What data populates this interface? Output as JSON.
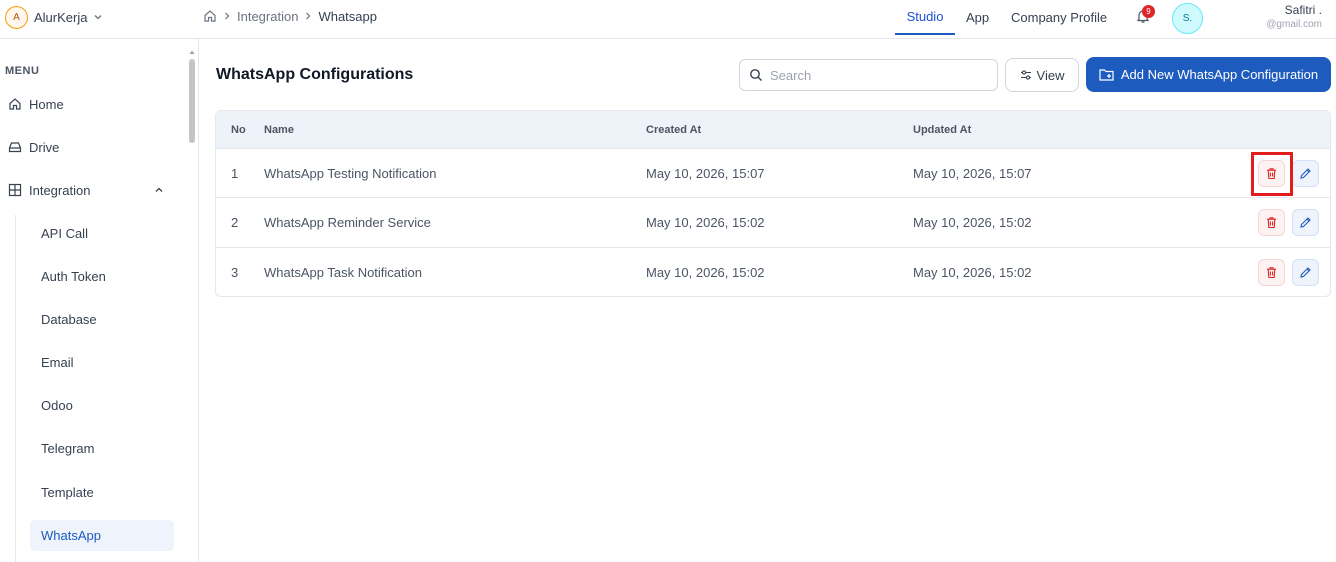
{
  "brand": {
    "initial": "A",
    "name": "AlurKerja"
  },
  "breadcrumb": {
    "items": [
      "Integration",
      "Whatsapp"
    ]
  },
  "topnav": {
    "studio": "Studio",
    "app": "App",
    "company_profile": "Company Profile"
  },
  "notifications": {
    "count": "9"
  },
  "user": {
    "initials": "S.",
    "name": "Safitri .",
    "email": "@gmail.com"
  },
  "sidebar": {
    "menu_label": "MENU",
    "home": "Home",
    "drive": "Drive",
    "integration": "Integration",
    "sub_items": [
      "API Call",
      "Auth Token",
      "Database",
      "Email",
      "Odoo",
      "Telegram",
      "Template",
      "WhatsApp"
    ],
    "active_sub_item": "WhatsApp"
  },
  "main": {
    "title": "WhatsApp Configurations",
    "search_placeholder": "Search",
    "view_label": "View",
    "add_label": "Add New WhatsApp Configuration"
  },
  "table": {
    "headers": {
      "no": "No",
      "name": "Name",
      "created": "Created At",
      "updated": "Updated At"
    },
    "rows": [
      {
        "no": "1",
        "name": "WhatsApp Testing Notification",
        "created": "May 10, 2026, 15:07",
        "updated": "May 10, 2026, 15:07"
      },
      {
        "no": "2",
        "name": "WhatsApp Reminder Service",
        "created": "May 10, 2026, 15:02",
        "updated": "May 10, 2026, 15:02"
      },
      {
        "no": "3",
        "name": "WhatsApp Task Notification",
        "created": "May 10, 2026, 15:02",
        "updated": "May 10, 2026, 15:02"
      }
    ]
  },
  "colors": {
    "primary": "#1d5bbf",
    "danger": "#dc2626",
    "highlight": "#e11d1d"
  },
  "icons": [
    "home-icon",
    "chevron-right-icon",
    "chevron-down-icon",
    "chevron-up-icon",
    "bell-icon",
    "drive-icon",
    "grid-icon",
    "search-icon",
    "sliders-icon",
    "folder-plus-icon",
    "trash-icon",
    "pencil-icon"
  ]
}
